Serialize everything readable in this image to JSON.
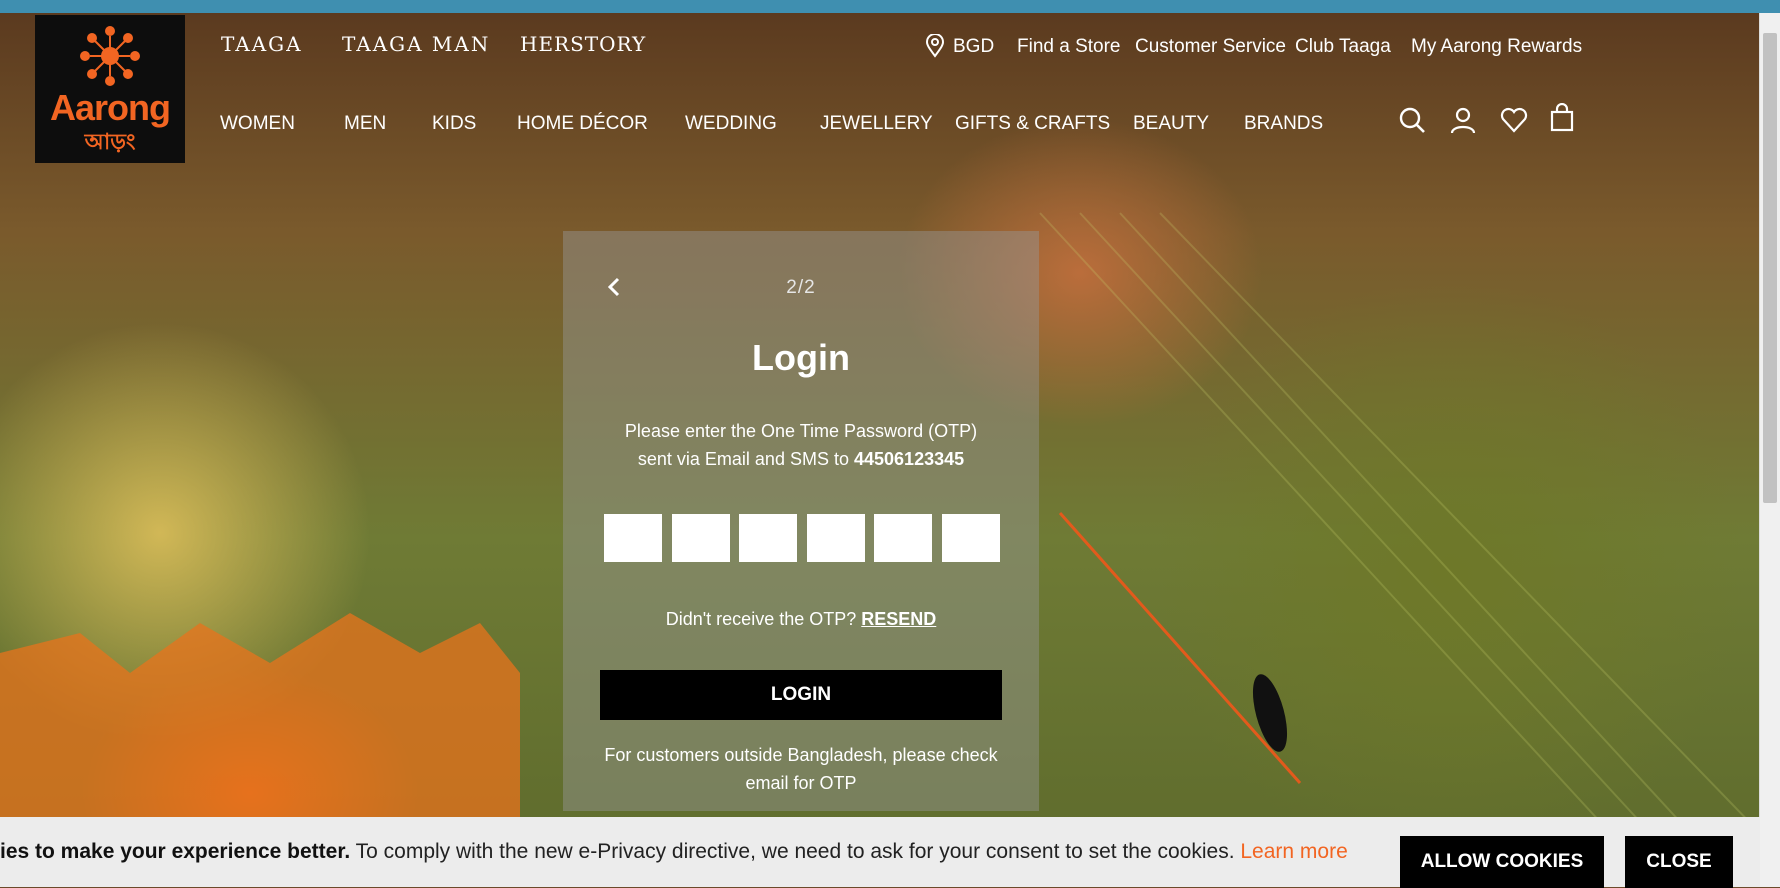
{
  "header": {
    "logo_text": "Aarong",
    "logo_bengali": "আড়ং",
    "brands": [
      "TAAGA",
      "TAAGA MAN",
      "HERSTORY"
    ],
    "utility": {
      "location": "BGD",
      "find_store": "Find a Store",
      "customer_service": "Customer Service",
      "club_taaga": "Club Taaga",
      "rewards": "My Aarong Rewards"
    },
    "menu": [
      "WOMEN",
      "MEN",
      "KIDS",
      "HOME DÉCOR",
      "WEDDING",
      "JEWELLERY",
      "GIFTS & CRAFTS",
      "BEAUTY",
      "BRANDS"
    ],
    "icons": [
      "search-icon",
      "account-icon",
      "wishlist-heart-icon",
      "shopping-bag-icon"
    ]
  },
  "login_modal": {
    "step": "2/2",
    "title": "Login",
    "instruction_line1": "Please enter the One Time Password (OTP)",
    "instruction_line2": "sent via Email and SMS to",
    "phone": "44506123345",
    "otp_prompt": "Didn't receive the OTP?",
    "resend": "RESEND",
    "login_button": "LOGIN",
    "note": "For customers outside Bangladesh, please check email for OTP"
  },
  "cookie_bar": {
    "bold_text": "ies to make your experience better.",
    "text": " To comply with the new e-Privacy directive, we need to ask for your consent to set the cookies. ",
    "learn_more": "Learn more",
    "allow_button": "ALLOW COOKIES",
    "close_button": "CLOSE"
  },
  "colors": {
    "brand_orange": "#f26522",
    "top_strip": "#3f8fb0"
  }
}
